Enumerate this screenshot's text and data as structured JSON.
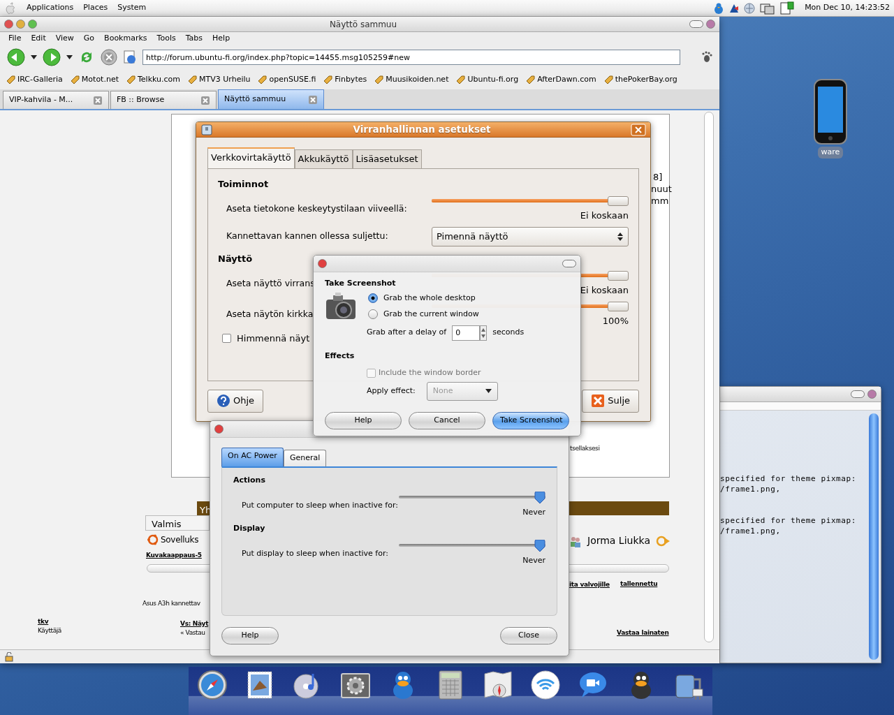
{
  "top_panel": {
    "menus": [
      "Applications",
      "Places",
      "System"
    ],
    "clock": "Mon Dec 10, 14:23:52"
  },
  "browser": {
    "title": "Näyttö sammuu",
    "menus": [
      "File",
      "Edit",
      "View",
      "Go",
      "Bookmarks",
      "Tools",
      "Tabs",
      "Help"
    ],
    "url": "http://forum.ubuntu-fi.org/index.php?topic=14455.msg105259#new",
    "bookmarks": [
      "IRC-Galleria",
      "Motot.net",
      "Telkku.com",
      "MTV3 Urheilu",
      "openSUSE.fi",
      "Finbytes",
      "Muusikoiden.net",
      "Ubuntu-fi.org",
      "AfterDawn.com",
      "thePokerBay.org"
    ],
    "tabs": [
      {
        "label": "VIP-kahvila - M...",
        "selected": false
      },
      {
        "label": "FB :: Browse",
        "selected": false
      },
      {
        "label": "Näyttö sammuu",
        "selected": true
      }
    ],
    "page_fragments": [
      {
        "kind": "text",
        "text": "8]"
      },
      {
        "kind": "text",
        "text": "nuut"
      },
      {
        "kind": "text",
        "text": "mm"
      },
      {
        "kind": "small",
        "text": "tsellaksesi"
      },
      {
        "kind": "banner",
        "text": "Yh"
      },
      {
        "kind": "status",
        "text": "Valmis"
      },
      {
        "kind": "app",
        "text": "Sovelluks"
      },
      {
        "kind": "user",
        "text": "Jorma Liukka"
      },
      {
        "kind": "link",
        "text": "Kuvakaappaus-5"
      },
      {
        "kind": "link",
        "text": "ita valvojille"
      },
      {
        "kind": "link",
        "text": "tallennettu"
      },
      {
        "kind": "small",
        "text": "Asus A3h kannettav"
      },
      {
        "kind": "link",
        "text": "tkv"
      },
      {
        "kind": "small",
        "text": "Käyttäjä"
      },
      {
        "kind": "link",
        "text": "Vs: Näyt"
      },
      {
        "kind": "small",
        "text": "« Vastau"
      },
      {
        "kind": "link",
        "text": "Vastaa lainaten"
      }
    ]
  },
  "power_settings_fi": {
    "title": "Virranhallinnan asetukset",
    "tabs": [
      {
        "label": "Verkkovirtakäyttö",
        "selected": true
      },
      {
        "label": "Akkukäyttö",
        "selected": false
      },
      {
        "label": "Lisäasetukset",
        "selected": false
      }
    ],
    "sections": [
      {
        "heading": "Toiminnot",
        "rows": [
          {
            "kind": "slider",
            "label": "Aseta tietokone keskeytystilaan viiveellä:",
            "level": 1,
            "reading": "Ei koskaan"
          },
          {
            "kind": "select",
            "label": "Kannettavan kannen ollessa suljettu:",
            "value": "Pimennä näyttö"
          }
        ]
      },
      {
        "heading": "Näyttö",
        "rows": [
          {
            "kind": "slider",
            "label": "Aseta näyttö virrans",
            "level": 1,
            "reading": "Ei koskaan"
          },
          {
            "kind": "slider",
            "label": "Aseta näytön kirkka",
            "level": 1,
            "reading": "100%"
          },
          {
            "kind": "checkbox",
            "label": "Himmennä näyt",
            "checked": false
          }
        ]
      }
    ],
    "buttons": [
      {
        "kind": "help",
        "label": "Ohje"
      },
      {
        "kind": "close",
        "label": "Sulje"
      }
    ]
  },
  "screenshot_dialog": {
    "heading": "Take Screenshot",
    "options": [
      {
        "label": "Grab the whole desktop",
        "selected": true
      },
      {
        "label": "Grab the current window",
        "selected": false
      }
    ],
    "delay": {
      "label": "Grab after a delay of",
      "value": "0",
      "unit": "seconds"
    },
    "effects": {
      "heading": "Effects",
      "border": {
        "label": "Include the window border",
        "checked": false,
        "disabled": true
      },
      "effect": {
        "label": "Apply effect:",
        "value": "None",
        "disabled": true
      }
    },
    "buttons": [
      {
        "kind": "normal",
        "label": "Help"
      },
      {
        "kind": "normal",
        "label": "Cancel"
      },
      {
        "kind": "default",
        "label": "Take Screenshot"
      }
    ]
  },
  "power_preferences": {
    "tabs": [
      {
        "label": "On AC Power",
        "selected": true
      },
      {
        "label": "General",
        "selected": false
      }
    ],
    "sections": [
      {
        "heading": "Actions",
        "rows": [
          {
            "label": "Put computer to sleep when inactive for:",
            "level": 1,
            "reading": "Never"
          }
        ]
      },
      {
        "heading": "Display",
        "rows": [
          {
            "label": "Put display to sleep when inactive for:",
            "level": 1,
            "reading": "Never"
          }
        ]
      }
    ],
    "buttons": [
      "Help",
      "Close"
    ]
  },
  "terminal": {
    "blocks": [
      [
        "specified for theme pixmap:",
        "/frame1.png,"
      ],
      [
        "specified for theme pixmap:",
        "/frame1.png,"
      ]
    ]
  },
  "desktop_icons": [
    {
      "label": "ware"
    }
  ]
}
